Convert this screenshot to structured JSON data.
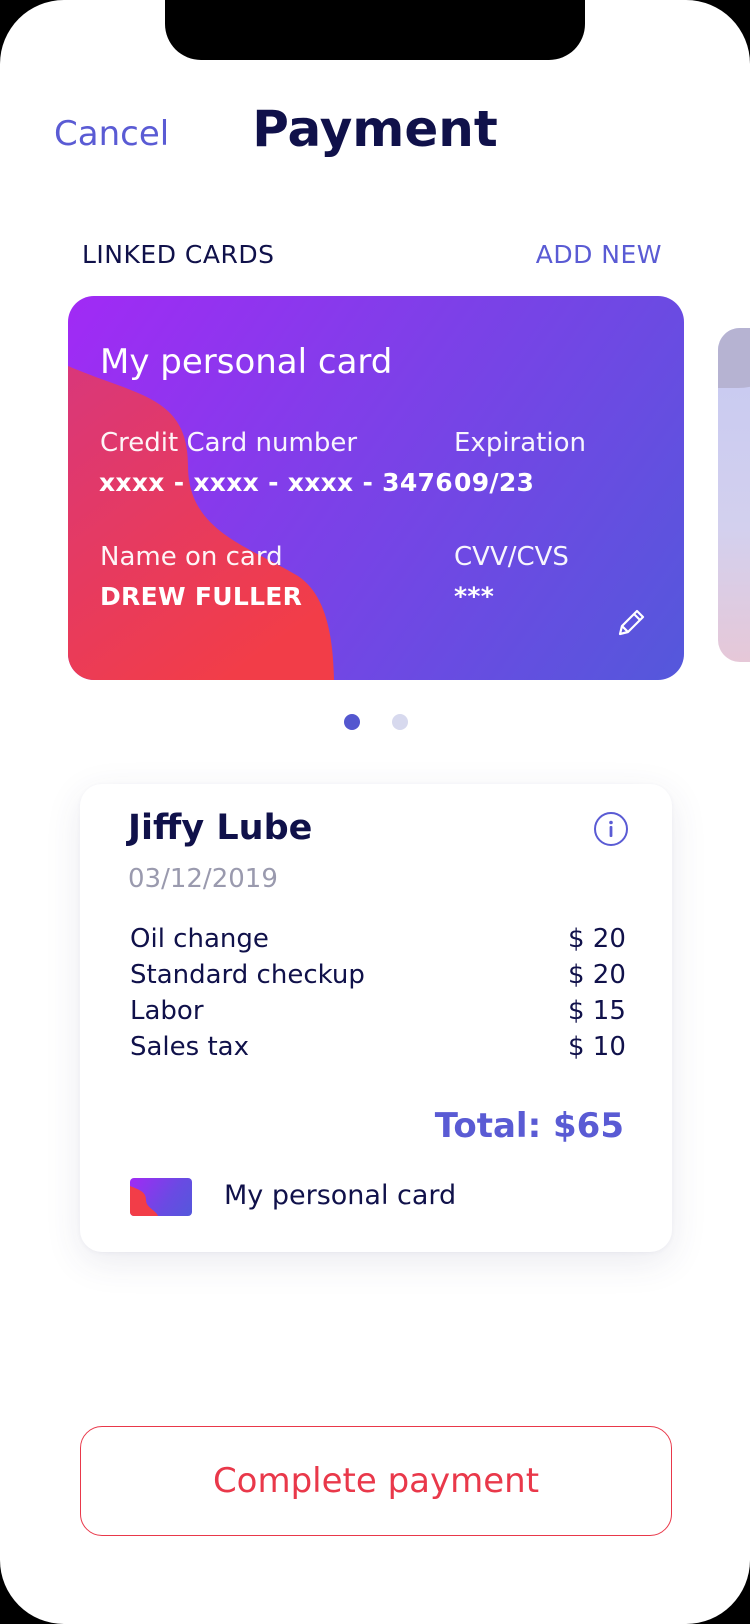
{
  "header": {
    "cancel_label": "Cancel",
    "title": "Payment"
  },
  "linked_cards": {
    "section_label": "LINKED CARDS",
    "add_new_label": "ADD NEW",
    "active_index": 0,
    "card_count": 2,
    "card": {
      "name": "My personal card",
      "number_label": "Credit Card number",
      "number_value": "xxxx - xxxx - xxxx - 3476",
      "expiration_label": "Expiration",
      "expiration_value": "09/23",
      "holder_label": "Name on card",
      "holder_value": "DREW FULLER",
      "cvv_label": "CVV/CVS",
      "cvv_value": "***",
      "edit_icon": "pencil-icon"
    }
  },
  "receipt": {
    "merchant": "Jiffy Lube",
    "date": "03/12/2019",
    "info_icon": "info-icon",
    "items": [
      {
        "name": "Oil change",
        "price": "$ 20"
      },
      {
        "name": "Standard checkup",
        "price": "$ 20"
      },
      {
        "name": "Labor",
        "price": "$ 15"
      },
      {
        "name": "Sales tax",
        "price": "$ 10"
      }
    ],
    "total": "Total: $65",
    "payment_method": "My personal card"
  },
  "actions": {
    "complete_label": "Complete payment"
  },
  "colors": {
    "accent": "#5a5bd4",
    "heading": "#10114a",
    "danger": "#e9384a",
    "card_gradient": [
      "#a12af5",
      "#5458db"
    ],
    "card_blob": "#f23d4a"
  }
}
